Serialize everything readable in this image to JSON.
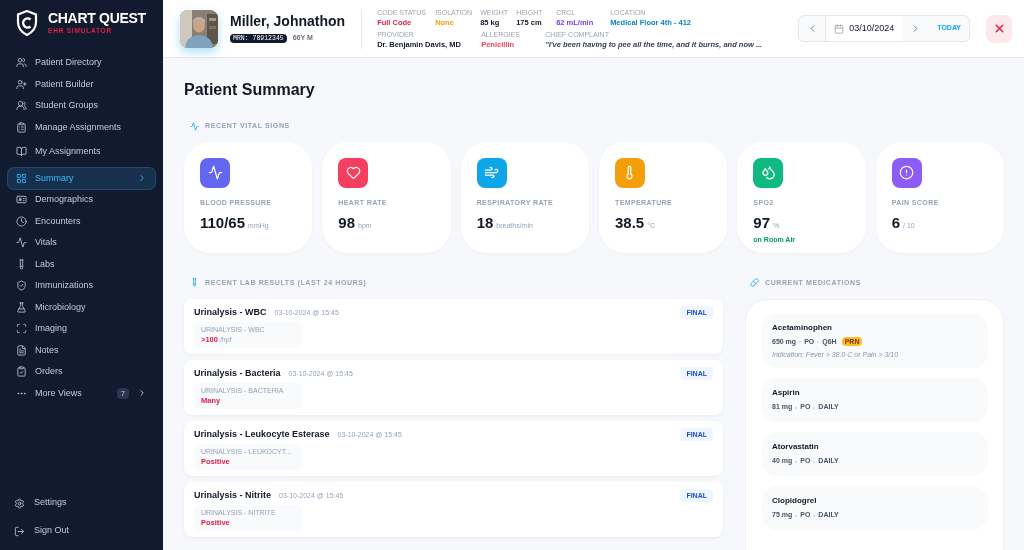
{
  "brand": {
    "name": "CHART QUEST",
    "subtitle": "EHR SIMULATOR"
  },
  "sidebar": {
    "groups": [
      [
        {
          "label": "Patient Directory",
          "selected": false
        },
        {
          "label": "Patient Builder",
          "selected": false
        },
        {
          "label": "Student Groups",
          "selected": false
        },
        {
          "label": "Manage Assignments",
          "selected": false
        }
      ],
      [
        {
          "label": "My Assignments",
          "selected": false
        }
      ],
      [
        {
          "label": "Summary",
          "selected": true,
          "chevron": true
        },
        {
          "label": "Demographics",
          "selected": false
        },
        {
          "label": "Encounters",
          "selected": false
        },
        {
          "label": "Vitals",
          "selected": false
        },
        {
          "label": "Labs",
          "selected": false
        },
        {
          "label": "Immunizations",
          "selected": false
        },
        {
          "label": "Microbiology",
          "selected": false
        },
        {
          "label": "Imaging",
          "selected": false
        },
        {
          "label": "Notes",
          "selected": false
        },
        {
          "label": "Orders",
          "selected": false
        },
        {
          "label": "More Views",
          "selected": false,
          "badge": "7",
          "chevron": true
        }
      ]
    ],
    "footer": [
      {
        "label": "Settings"
      },
      {
        "label": "Sign Out"
      }
    ]
  },
  "patient": {
    "name": "Miller, Johnathon",
    "mrn": "MRN: 78912345",
    "age_sex": "66Y M"
  },
  "header_fields": [
    [
      {
        "label": "CODE STATUS",
        "value": "Full Code",
        "color": "#e11d48"
      },
      {
        "label": "ISOLATION",
        "value": "None",
        "color": "#f59e0b"
      },
      {
        "label": "WEIGHT",
        "value": "85 kg",
        "color": "#111827"
      },
      {
        "label": "HEIGHT",
        "value": "175 cm",
        "color": "#111827"
      },
      {
        "label": "CRCL",
        "value": "62 mL/min",
        "color": "#7c3aed"
      },
      {
        "label": "LOCATION",
        "value": "Medical Floor 4th - 412",
        "color": "#0284c7"
      }
    ],
    [
      {
        "label": "PROVIDER",
        "value": "Dr. Benjamin Davis, MD",
        "color": "#111827"
      },
      {
        "label": "ALLERGIES",
        "value": "Penicillin",
        "color": "#f43f5e"
      },
      {
        "label": "CHIEF COMPLAINT",
        "value": "\"I've been having to pee all the time, and it burns, and now ...",
        "color": "#374151",
        "italic": true
      }
    ]
  ],
  "date_nav": {
    "date": "03/10/2024",
    "today": "TODAY"
  },
  "page_title": "Patient Summary",
  "vitals": {
    "title": "RECENT VITAL SIGNS",
    "items": [
      {
        "label": "BLOOD PRESSURE",
        "value": "110/65",
        "unit": "mmHg",
        "color": "#6366f1"
      },
      {
        "label": "HEART RATE",
        "value": "98",
        "unit": "bpm",
        "color": "#f43f5e"
      },
      {
        "label": "RESPIRATORY RATE",
        "value": "18",
        "unit": "breaths/min",
        "color": "#0ea5e9"
      },
      {
        "label": "TEMPERATURE",
        "value": "38.5",
        "unit": "°C",
        "color": "#f59e0b"
      },
      {
        "label": "SPO2",
        "value": "97",
        "unit": "%",
        "color": "#10b981",
        "note": "on Room Air"
      },
      {
        "label": "PAIN SCORE",
        "value": "6",
        "unit": "/ 10",
        "color": "#8b5cf6"
      }
    ]
  },
  "labs": {
    "title": "RECENT LAB RESULTS (LAST 24 HOURS)",
    "items": [
      {
        "name": "Urinalysis - WBC",
        "time": "03-10-2024 @ 15:45",
        "status": "FINAL",
        "result_label": "URINALYSIS - WBC",
        "value": ">100",
        "unit": "/hpf",
        "abnormal": true
      },
      {
        "name": "Urinalysis - Bacteria",
        "time": "03-10-2024 @ 15:45",
        "status": "FINAL",
        "result_label": "URINALYSIS - BACTERIA",
        "value": "Many",
        "abnormal": true
      },
      {
        "name": "Urinalysis - Leukocyte Esterase",
        "time": "03-10-2024 @ 15:45",
        "status": "FINAL",
        "result_label": "URINALYSIS - LEUKOCYT...",
        "value": "Positive",
        "abnormal": true
      },
      {
        "name": "Urinalysis - Nitrite",
        "time": "03-10-2024 @ 15:45",
        "status": "FINAL",
        "result_label": "URINALYSIS - NITRITE",
        "value": "Positive",
        "abnormal": true
      }
    ]
  },
  "medications": {
    "title": "CURRENT MEDICATIONS",
    "items": [
      {
        "name": "Acetaminophen",
        "dose": "650 mg",
        "route": "PO",
        "frequency": "Q6H",
        "badge": "PRN",
        "indication": "Indication: Fever > 38.0 C or Pain > 3/10"
      },
      {
        "name": "Aspirin",
        "dose": "81 mg",
        "route": "PO",
        "frequency": "DAILY"
      },
      {
        "name": "Atorvastatin",
        "dose": "40 mg",
        "route": "PO",
        "frequency": "DAILY"
      },
      {
        "name": "Clopidogrel",
        "dose": "75 mg",
        "route": "PO",
        "frequency": "DAILY"
      }
    ]
  }
}
